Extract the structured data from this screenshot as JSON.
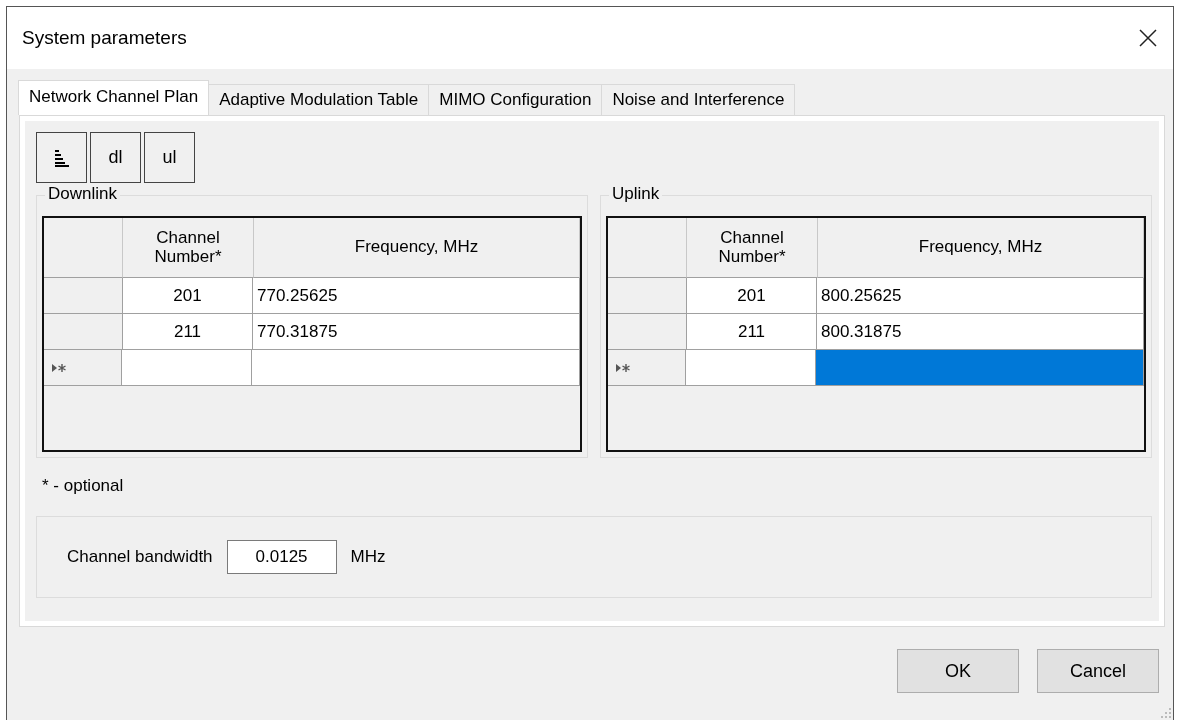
{
  "window": {
    "title": "System parameters"
  },
  "tabs": [
    {
      "label": "Network Channel Plan",
      "selected": true
    },
    {
      "label": "Adaptive Modulation Table",
      "selected": false
    },
    {
      "label": "MIMO Configuration",
      "selected": false
    },
    {
      "label": "Noise and Interference",
      "selected": false
    }
  ],
  "toolbar": [
    {
      "kind": "icon"
    },
    {
      "kind": "text",
      "label": "dl"
    },
    {
      "kind": "text",
      "label": "ul"
    }
  ],
  "groups": [
    {
      "title": "Downlink",
      "columns": [
        "Channel Number*",
        "Frequency, MHz"
      ],
      "rows": [
        [
          "201",
          "770.25625"
        ],
        [
          "211",
          "770.31875"
        ]
      ],
      "new_row": [
        {
          "selected": false
        },
        {
          "selected": false
        }
      ]
    },
    {
      "title": "Uplink",
      "columns": [
        "Channel Number*",
        "Frequency, MHz"
      ],
      "rows": [
        [
          "201",
          "800.25625"
        ],
        [
          "211",
          "800.31875"
        ]
      ],
      "new_row": [
        {
          "selected": false
        },
        {
          "selected": true
        }
      ]
    }
  ],
  "footnote": "* - optional",
  "bandwidth": {
    "label": "Channel bandwidth",
    "value": "0.0125",
    "unit": "MHz"
  },
  "buttons": [
    "OK",
    "Cancel"
  ]
}
